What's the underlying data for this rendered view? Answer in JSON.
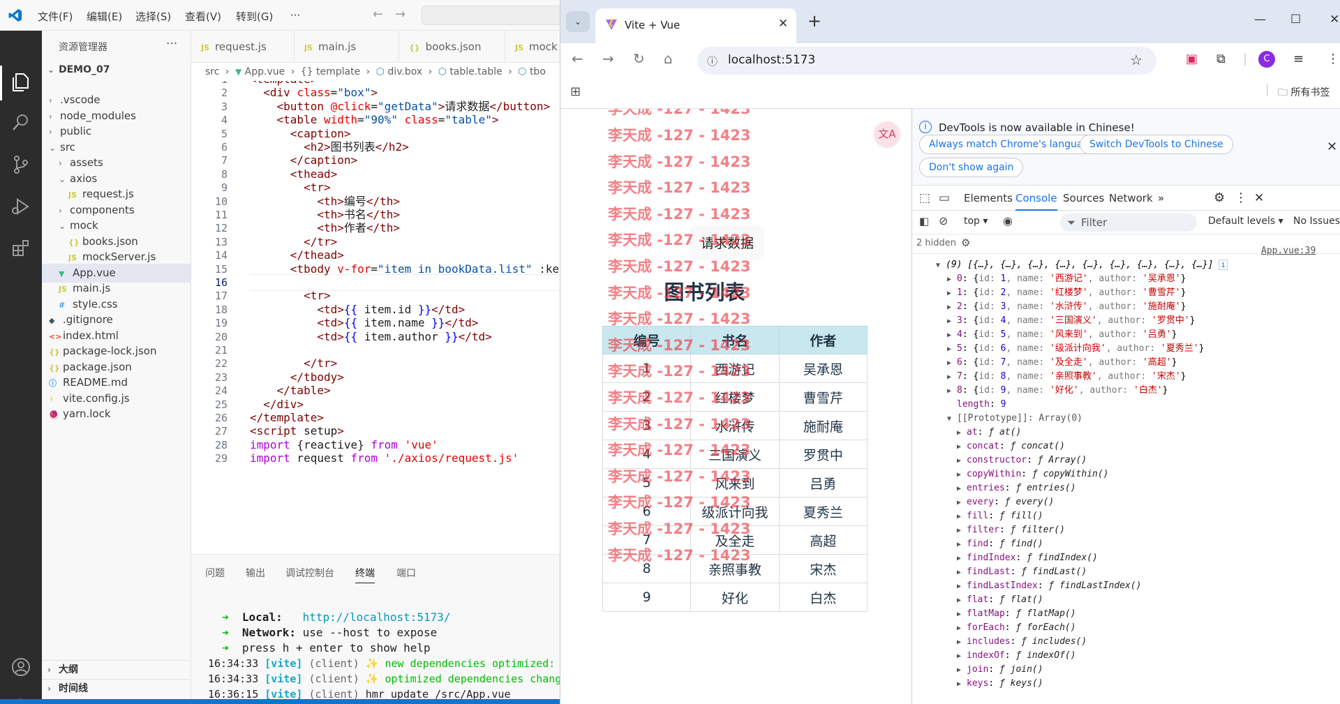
{
  "vscode": {
    "menus": [
      "文件(F)",
      "编辑(E)",
      "选择(S)",
      "查看(V)",
      "转到(G)",
      "···"
    ],
    "explorer_title": "资源管理器",
    "explorer_more": "···",
    "project": "DEMO_07",
    "tree": [
      {
        "label": ".vscode",
        "kind": "folder",
        "depth": 1,
        "open": false
      },
      {
        "label": "node_modules",
        "kind": "folder",
        "depth": 1,
        "open": false
      },
      {
        "label": "public",
        "kind": "folder",
        "depth": 1,
        "open": false
      },
      {
        "label": "src",
        "kind": "folder",
        "depth": 1,
        "open": true
      },
      {
        "label": "assets",
        "kind": "folder",
        "depth": 2,
        "open": false
      },
      {
        "label": "axios",
        "kind": "folder",
        "depth": 2,
        "open": true
      },
      {
        "label": "request.js",
        "kind": "js",
        "depth": 3
      },
      {
        "label": "components",
        "kind": "folder",
        "depth": 2,
        "open": false
      },
      {
        "label": "mock",
        "kind": "folder",
        "depth": 2,
        "open": true
      },
      {
        "label": "books.json",
        "kind": "json",
        "depth": 3
      },
      {
        "label": "mockServer.js",
        "kind": "js",
        "depth": 3
      },
      {
        "label": "App.vue",
        "kind": "vue",
        "depth": 2,
        "selected": true
      },
      {
        "label": "main.js",
        "kind": "js",
        "depth": 2
      },
      {
        "label": "style.css",
        "kind": "css",
        "depth": 2
      },
      {
        "label": ".gitignore",
        "kind": "git",
        "depth": 1
      },
      {
        "label": "index.html",
        "kind": "html",
        "depth": 1
      },
      {
        "label": "package-lock.json",
        "kind": "json",
        "depth": 1
      },
      {
        "label": "package.json",
        "kind": "json",
        "depth": 1
      },
      {
        "label": "README.md",
        "kind": "md",
        "depth": 1
      },
      {
        "label": "vite.config.js",
        "kind": "vite",
        "depth": 1
      },
      {
        "label": "yarn.lock",
        "kind": "yarn",
        "depth": 1
      }
    ],
    "sections": [
      "大纲",
      "时间线"
    ],
    "tabs": [
      {
        "label": "request.js",
        "icon": "JS"
      },
      {
        "label": "main.js",
        "icon": "JS"
      },
      {
        "label": "books.json",
        "icon": "{}"
      },
      {
        "label": "mock",
        "icon": "JS"
      }
    ],
    "breadcrumbs": [
      "src",
      "App.vue",
      "{} template",
      "div.box",
      "table.table",
      "tbo"
    ],
    "current_line": 16,
    "code_lines": [
      "<template>",
      "  <div class=\"box\">",
      "    <button @click=\"getData\">请求数据</button>",
      "    <table width=\"90%\" class=\"table\">",
      "      <caption>",
      "        <h2>图书列表</h2>",
      "      </caption>",
      "      <thead>",
      "        <tr>",
      "          <th>编号</th>",
      "          <th>书名</th>",
      "          <th>作者</th>",
      "        </tr>",
      "      </thead>",
      "      <tbody v-for=\"item in bookData.list\" :ke",
      "",
      "        <tr>",
      "          <td>{{ item.id }}</td>",
      "          <td>{{ item.name }}</td>",
      "          <td>{{ item.author }}</td>",
      "",
      "        </tr>",
      "      </tbody>",
      "    </table>",
      "  </div>",
      "</template>",
      "<script setup>",
      "import {reactive} from 'vue'",
      "import request from './axios/request.js'"
    ],
    "panel_tabs": [
      "问题",
      "输出",
      "调试控制台",
      "终端",
      "端口"
    ],
    "panel_active": "终端",
    "terminal": {
      "local_label": "Local:",
      "local_url": "http://localhost:5173/",
      "network_label": "Network:",
      "network_text": "use --host to expose",
      "help_text": "press h + enter to show help",
      "logs": [
        {
          "time": "16:34:33",
          "tag": "[vite]",
          "src": "(client)",
          "msg": "new dependencies optimized:"
        },
        {
          "time": "16:34:33",
          "tag": "[vite]",
          "src": "(client)",
          "msg": "optimized dependencies chang"
        },
        {
          "time": "16:36:15",
          "tag": "[vite]",
          "src": "(client)",
          "msg": "hmr update /src/App.vue"
        }
      ]
    }
  },
  "chrome": {
    "tab_title": "Vite + Vue",
    "url": "localhost:5173",
    "avatar_letter": "C",
    "bookmarks_all": "所有书签",
    "page": {
      "button": "请求数据",
      "caption": "图书列表",
      "headers": [
        "编号",
        "书名",
        "作者"
      ],
      "rows": [
        [
          "1",
          "西游记",
          "吴承恩"
        ],
        [
          "2",
          "红楼梦",
          "曹雪芹"
        ],
        [
          "3",
          "水浒传",
          "施耐庵"
        ],
        [
          "4",
          "三国演义",
          "罗贯中"
        ],
        [
          "5",
          "风来到",
          "吕勇"
        ],
        [
          "6",
          "级派计向我",
          "夏秀兰"
        ],
        [
          "7",
          "及全走",
          "高超"
        ],
        [
          "8",
          "亲照事教",
          "宋杰"
        ],
        [
          "9",
          "好化",
          "白杰"
        ]
      ],
      "watermark": "李天成 -127 - 1423"
    },
    "devtools": {
      "info_text": "DevTools is now available in Chinese!",
      "btn_match": "Always match Chrome's language",
      "btn_switch": "Switch DevTools to Chinese",
      "btn_dont": "Don't show again",
      "tabs": [
        "Elements",
        "Console",
        "Sources",
        "Network"
      ],
      "active_tab": "Console",
      "context": "top",
      "filter_placeholder": "Filter",
      "levels": "Default levels",
      "no_issues": "No Issues",
      "hidden_count": "2 hidden",
      "source_link": "App.vue:39",
      "array_summary": "(9) [{…}, {…}, {…}, {…}, {…}, {…}, {…}, {…}, {…}]",
      "items": [
        {
          "idx": "0",
          "id": "1",
          "name": "'西游记'",
          "author": "'吴承恩'"
        },
        {
          "idx": "1",
          "id": "2",
          "name": "'红楼梦'",
          "author": "'曹雪芹'"
        },
        {
          "idx": "2",
          "id": "3",
          "name": "'水浒传'",
          "author": "'施耐庵'"
        },
        {
          "idx": "3",
          "id": "4",
          "name": "'三国演义'",
          "author": "'罗贯中'"
        },
        {
          "idx": "4",
          "id": "5",
          "name": "'风来到'",
          "author": "'吕勇'"
        },
        {
          "idx": "5",
          "id": "6",
          "name": "'级派计向我'",
          "author": "'夏秀兰'"
        },
        {
          "idx": "6",
          "id": "7",
          "name": "'及全走'",
          "author": "'高超'"
        },
        {
          "idx": "7",
          "id": "8",
          "name": "'亲照事教'",
          "author": "'宋杰'"
        },
        {
          "idx": "8",
          "id": "9",
          "name": "'好化'",
          "author": "'白杰'"
        }
      ],
      "length_label": "length",
      "length_value": "9",
      "prototype": "[[Prototype]]: Array(0)",
      "methods": [
        "at",
        "concat",
        "constructor",
        "copyWithin",
        "entries",
        "every",
        "fill",
        "filter",
        "find",
        "findIndex",
        "findLast",
        "findLastIndex",
        "flat",
        "flatMap",
        "forEach",
        "includes",
        "indexOf",
        "join",
        "keys"
      ],
      "constructor_value": "Array()"
    }
  }
}
